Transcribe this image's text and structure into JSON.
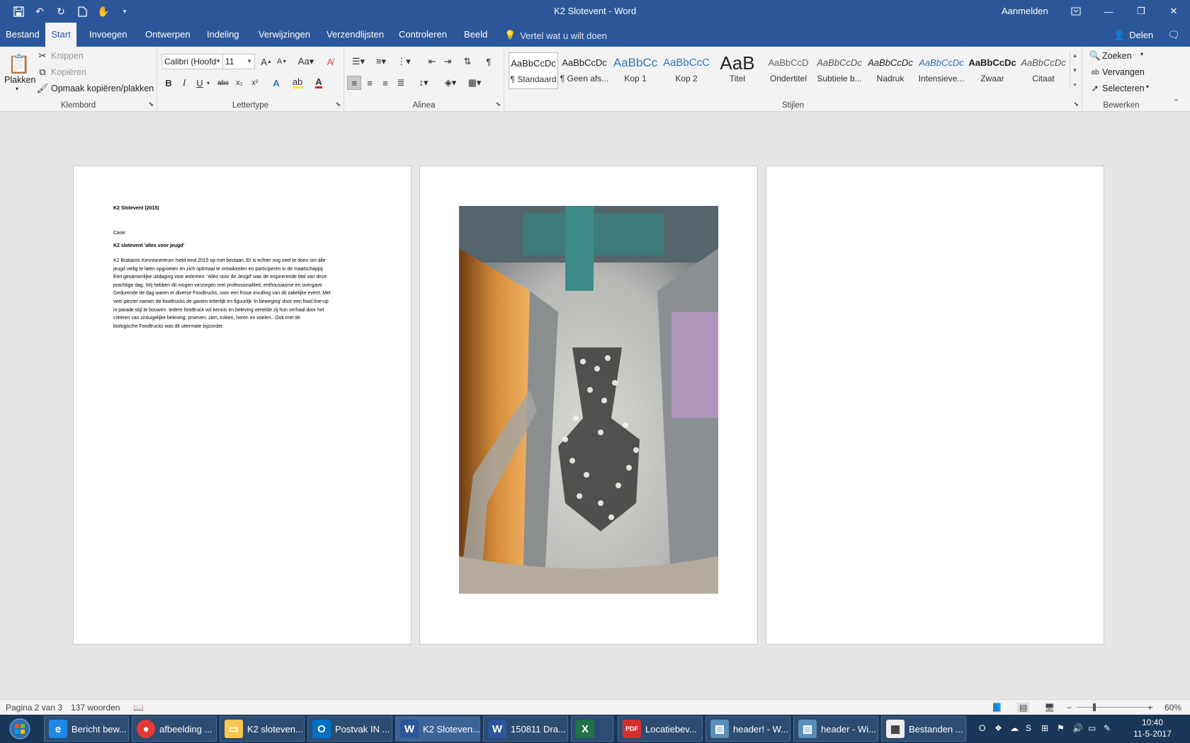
{
  "window": {
    "title": "K2 Slotevent  -  Word",
    "signin": "Aanmelden"
  },
  "tabs": [
    {
      "label": "Bestand"
    },
    {
      "label": "Start"
    },
    {
      "label": "Invoegen"
    },
    {
      "label": "Ontwerpen"
    },
    {
      "label": "Indeling"
    },
    {
      "label": "Verwijzingen"
    },
    {
      "label": "Verzendlijsten"
    },
    {
      "label": "Controleren"
    },
    {
      "label": "Beeld"
    }
  ],
  "tellme": "Vertel wat u wilt doen",
  "share": "Delen",
  "clipboard": {
    "paste": "Plakken",
    "cut": "Knippen",
    "copy": "Kopiëren",
    "format_painter": "Opmaak kopiëren/plakken",
    "label": "Klembord"
  },
  "font": {
    "name": "Calibri (Hoofd",
    "size": "11",
    "label": "Lettertype",
    "bold": "B",
    "italic": "I",
    "underline": "U",
    "strike": "abc"
  },
  "paragraph": {
    "label": "Alinea"
  },
  "styles": {
    "label": "Stijlen",
    "items": [
      {
        "sample": "AaBbCcDc",
        "name": "¶ Standaard"
      },
      {
        "sample": "AaBbCcDc",
        "name": "¶ Geen afs..."
      },
      {
        "sample": "AaBbCc",
        "name": "Kop 1"
      },
      {
        "sample": "AaBbCcC",
        "name": "Kop 2"
      },
      {
        "sample": "AaB",
        "name": "Titel"
      },
      {
        "sample": "AaBbCcD",
        "name": "Ondertitel"
      },
      {
        "sample": "AaBbCcDc",
        "name": "Subtiele b..."
      },
      {
        "sample": "AaBbCcDc",
        "name": "Nadruk"
      },
      {
        "sample": "AaBbCcDc",
        "name": "Intensieve..."
      },
      {
        "sample": "AaBbCcDc",
        "name": "Zwaar"
      },
      {
        "sample": "AaBbCcDc",
        "name": "Citaat"
      }
    ]
  },
  "editing": {
    "find": "Zoeken",
    "replace": "Vervangen",
    "select": "Selecteren",
    "label": "Bewerken"
  },
  "document": {
    "title": "K2 Slotevent (2015)",
    "case_label": "Case:",
    "subtitle": "K2 slotevent 'alles voor jeugd'",
    "body": "K2 Brabants Kenniscentrum hield eind 2015 op met bestaan. Er is echter nog veel te doen om álle\njeugd veilig te laten opgroeien en zich optimaal te ontwikkelen en participeren in de maatschappij.\nEen gesamenlijke uitdaging voor iedereen. 'Alles voor de Jeugd' was de inspirerende titel van deze\nprachtige dag. Wij hebben dit mogen verzorgen met professionaliteit, enthousiasme en overgave.\nGedurende de dag waren er diverse Foodtrucks, voor een frisse invulling van dit zakelijke event. Met\nveel plezier namen de foodtrucks de gasten letterlijk en figuurlijk 'in beweging' door een food line-up\nin parade stijl  te bouwen. Iedere foodtruck vol kennis en beleving vertelde zij hun verhaal door het\ncreëren van zintuigelijke beleving; proeven, zien, ruiken, horen en voelen.. Ook met de\nbiologische Foodtrucks was dit uitermate bijzonder."
  },
  "status": {
    "page": "Pagina 2 van 3",
    "words": "137 woorden",
    "zoom": "60%"
  },
  "taskbar": [
    {
      "label": "Bericht bew...",
      "icon": "ie-icon",
      "color": "#1e88e5"
    },
    {
      "label": "afbeelding ...",
      "icon": "chrome-icon",
      "color": "#e53935"
    },
    {
      "label": "K2 sloteven...",
      "icon": "folder-icon",
      "color": "#f9c74f"
    },
    {
      "label": "Postvak IN ...",
      "icon": "outlook-icon",
      "color": "#0072c6"
    },
    {
      "label": "K2 Sloteven...",
      "icon": "word-icon",
      "color": "#2b579a"
    },
    {
      "label": "150811 Dra...",
      "icon": "word-icon",
      "color": "#2b579a"
    },
    {
      "label": "",
      "icon": "excel-icon",
      "color": "#217346"
    },
    {
      "label": "Locatiebev...",
      "icon": "pdf-icon",
      "color": "#d32f2f"
    },
    {
      "label": "header! - W...",
      "icon": "photo-icon",
      "color": "#5b8fb9"
    },
    {
      "label": "header - Wi...",
      "icon": "photo-icon",
      "color": "#5b8fb9"
    },
    {
      "label": "Bestanden ...",
      "icon": "calendar-icon",
      "color": "#eeeeee"
    }
  ],
  "clock": {
    "time": "10:40",
    "date": "11-5-2017"
  }
}
